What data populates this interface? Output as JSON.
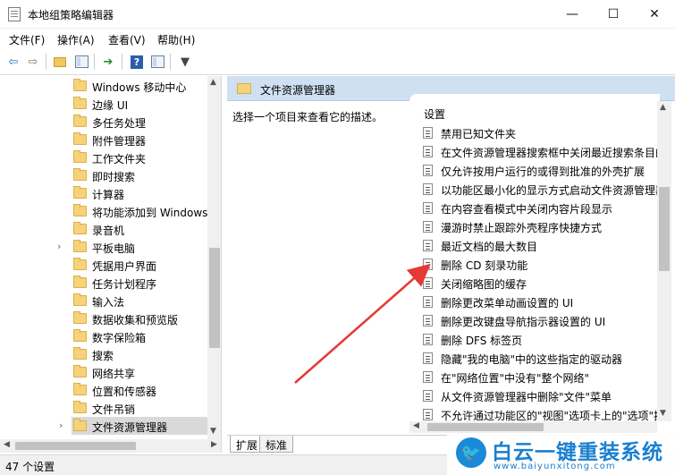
{
  "window": {
    "title": "本地组策略编辑器",
    "min_glyph": "—",
    "max_glyph": "☐",
    "close_glyph": "✕"
  },
  "menu": [
    "文件(F)",
    "操作(A)",
    "查看(V)",
    "帮助(H)"
  ],
  "toolbar": {
    "back_glyph": "⇦",
    "forward_glyph": "⇨",
    "export_glyph": "➔",
    "help_glyph": "?",
    "filter_glyph": "▼"
  },
  "tree": {
    "items": [
      {
        "label": "Windows 移动中心",
        "expandable": false
      },
      {
        "label": "边缘 UI",
        "expandable": false
      },
      {
        "label": "多任务处理",
        "expandable": false
      },
      {
        "label": "附件管理器",
        "expandable": false
      },
      {
        "label": "工作文件夹",
        "expandable": false
      },
      {
        "label": "即时搜索",
        "expandable": false
      },
      {
        "label": "计算器",
        "expandable": false
      },
      {
        "label": "将功能添加到 Windows",
        "expandable": false
      },
      {
        "label": "录音机",
        "expandable": false
      },
      {
        "label": "平板电脑",
        "expandable": true
      },
      {
        "label": "凭据用户界面",
        "expandable": false
      },
      {
        "label": "任务计划程序",
        "expandable": false
      },
      {
        "label": "输入法",
        "expandable": false
      },
      {
        "label": "数据收集和预览版",
        "expandable": false
      },
      {
        "label": "数字保险箱",
        "expandable": false
      },
      {
        "label": "搜索",
        "expandable": false
      },
      {
        "label": "网络共享",
        "expandable": false
      },
      {
        "label": "位置和传感器",
        "expandable": false
      },
      {
        "label": "文件吊销",
        "expandable": false
      },
      {
        "label": "文件资源管理器",
        "expandable": true,
        "selected": true
      }
    ]
  },
  "right": {
    "header_title": "文件资源管理器",
    "description": "选择一个项目来查看它的描述。",
    "settings_header": "设置",
    "settings": [
      "禁用已知文件夹",
      "在文件资源管理器搜索框中关闭最近搜索条目的",
      "仅允许按用户运行的或得到批准的外壳扩展",
      "以功能区最小化的显示方式启动文件资源管理器",
      "在内容查看模式中关闭内容片段显示",
      "漫游时禁止跟踪外壳程序快捷方式",
      "最近文档的最大数目",
      "删除 CD 刻录功能",
      "关闭缩略图的缓存",
      "删除更改菜单动画设置的 UI",
      "删除更改键盘导航指示器设置的 UI",
      "删除 DFS 标签页",
      "隐藏\"我的电脑\"中的这些指定的驱动器",
      "在\"网络位置\"中没有\"整个网络\"",
      "从文件资源管理器中删除\"文件\"菜单",
      "不允许通过功能区的\"视图\"选项卡上的\"选项\"按"
    ],
    "tabs": [
      "扩展",
      "标准"
    ]
  },
  "status": {
    "text": "47 个设置"
  },
  "annotation": {
    "arrow_color": "#e53935"
  },
  "watermark": {
    "text": "白云一键重装系统",
    "url": "www.baiyunxitong.com"
  }
}
